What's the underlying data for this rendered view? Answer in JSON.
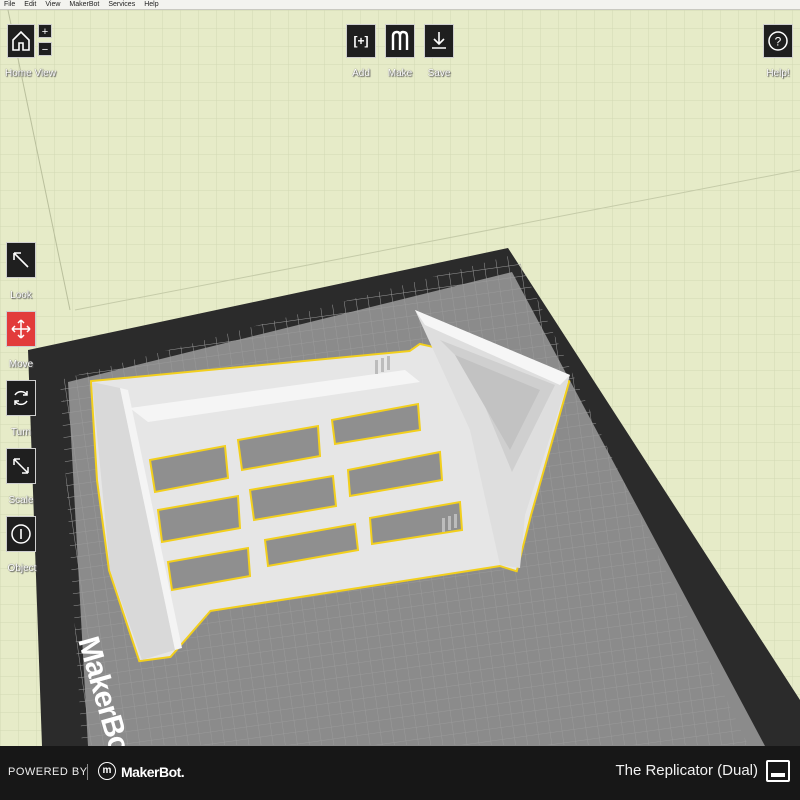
{
  "menu": [
    "File",
    "Edit",
    "View",
    "MakerBot",
    "Services",
    "Help"
  ],
  "toolbar": {
    "home_view": "Home View",
    "add": "Add",
    "add_glyph": "[+]",
    "make": "Make",
    "save": "Save",
    "help": "Help!"
  },
  "tools": {
    "look": "Look",
    "move": "Move",
    "turn": "Turn",
    "scale": "Scale",
    "object": "Object"
  },
  "plate_brand": "MakerBot",
  "bottom": {
    "powered_by": "POWERED BY",
    "brand": "MakerBot.",
    "logo_glyph": "m",
    "machine": "The Replicator (Dual)"
  },
  "colors": {
    "background": "#e6ebc8",
    "plate_frame": "#2b2b2b",
    "plate_surface": "#8a8a8a",
    "model": "#e9e9e9",
    "model_outline": "#f2cf1d",
    "move_active": "#e23b3b"
  }
}
